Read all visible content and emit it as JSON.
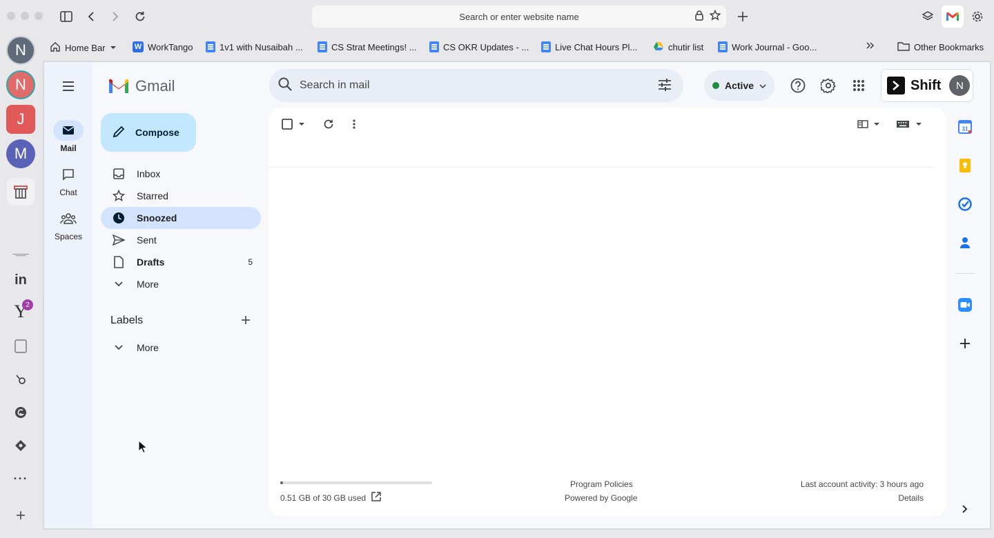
{
  "browser": {
    "url_placeholder": "Search or enter website name",
    "bookmarks": [
      {
        "label": "Home Bar",
        "icon": "home-icon"
      },
      {
        "label": "WorkTango",
        "icon": "worktango-icon"
      },
      {
        "label": "1v1 with Nusaibah ...",
        "icon": "doc-icon"
      },
      {
        "label": "CS Strat Meetings! ...",
        "icon": "doc-icon"
      },
      {
        "label": "CS OKR Updates - ...",
        "icon": "doc-icon"
      },
      {
        "label": "Live Chat Hours Pl...",
        "icon": "doc-icon"
      },
      {
        "label": "chutir list",
        "icon": "drive-icon"
      },
      {
        "label": "Work Journal - Goo...",
        "icon": "doc-icon"
      }
    ],
    "other_bookmarks": "Other Bookmarks"
  },
  "dock": {
    "avatars": [
      {
        "letter": "N",
        "color": "#5f6b7a"
      },
      {
        "letter": "N",
        "color": "#e06b6b"
      },
      {
        "letter": "J",
        "color": "#e05a5a"
      },
      {
        "letter": "M",
        "color": "#5a62b8"
      }
    ],
    "yahoo_badge": "2"
  },
  "gmail": {
    "logo_text": "Gmail",
    "compose_label": "Compose",
    "rail": [
      {
        "label": "Mail"
      },
      {
        "label": "Chat"
      },
      {
        "label": "Spaces"
      }
    ],
    "nav": [
      {
        "label": "Inbox",
        "count": ""
      },
      {
        "label": "Starred",
        "count": ""
      },
      {
        "label": "Snoozed",
        "count": ""
      },
      {
        "label": "Sent",
        "count": ""
      },
      {
        "label": "Drafts",
        "count": "5"
      },
      {
        "label": "More",
        "count": ""
      }
    ],
    "labels_heading": "Labels",
    "labels_more": "More",
    "search_placeholder": "Search in mail",
    "status_label": "Active",
    "shift_label": "Shift",
    "shift_avatar": "N",
    "footer": {
      "storage_text": "0.51 GB of 30 GB used",
      "storage_fraction": 0.017,
      "program_policies": "Program Policies",
      "powered_by": "Powered by Google",
      "last_activity": "Last account activity: 3 hours ago",
      "details": "Details"
    },
    "calendar_day": "31"
  }
}
